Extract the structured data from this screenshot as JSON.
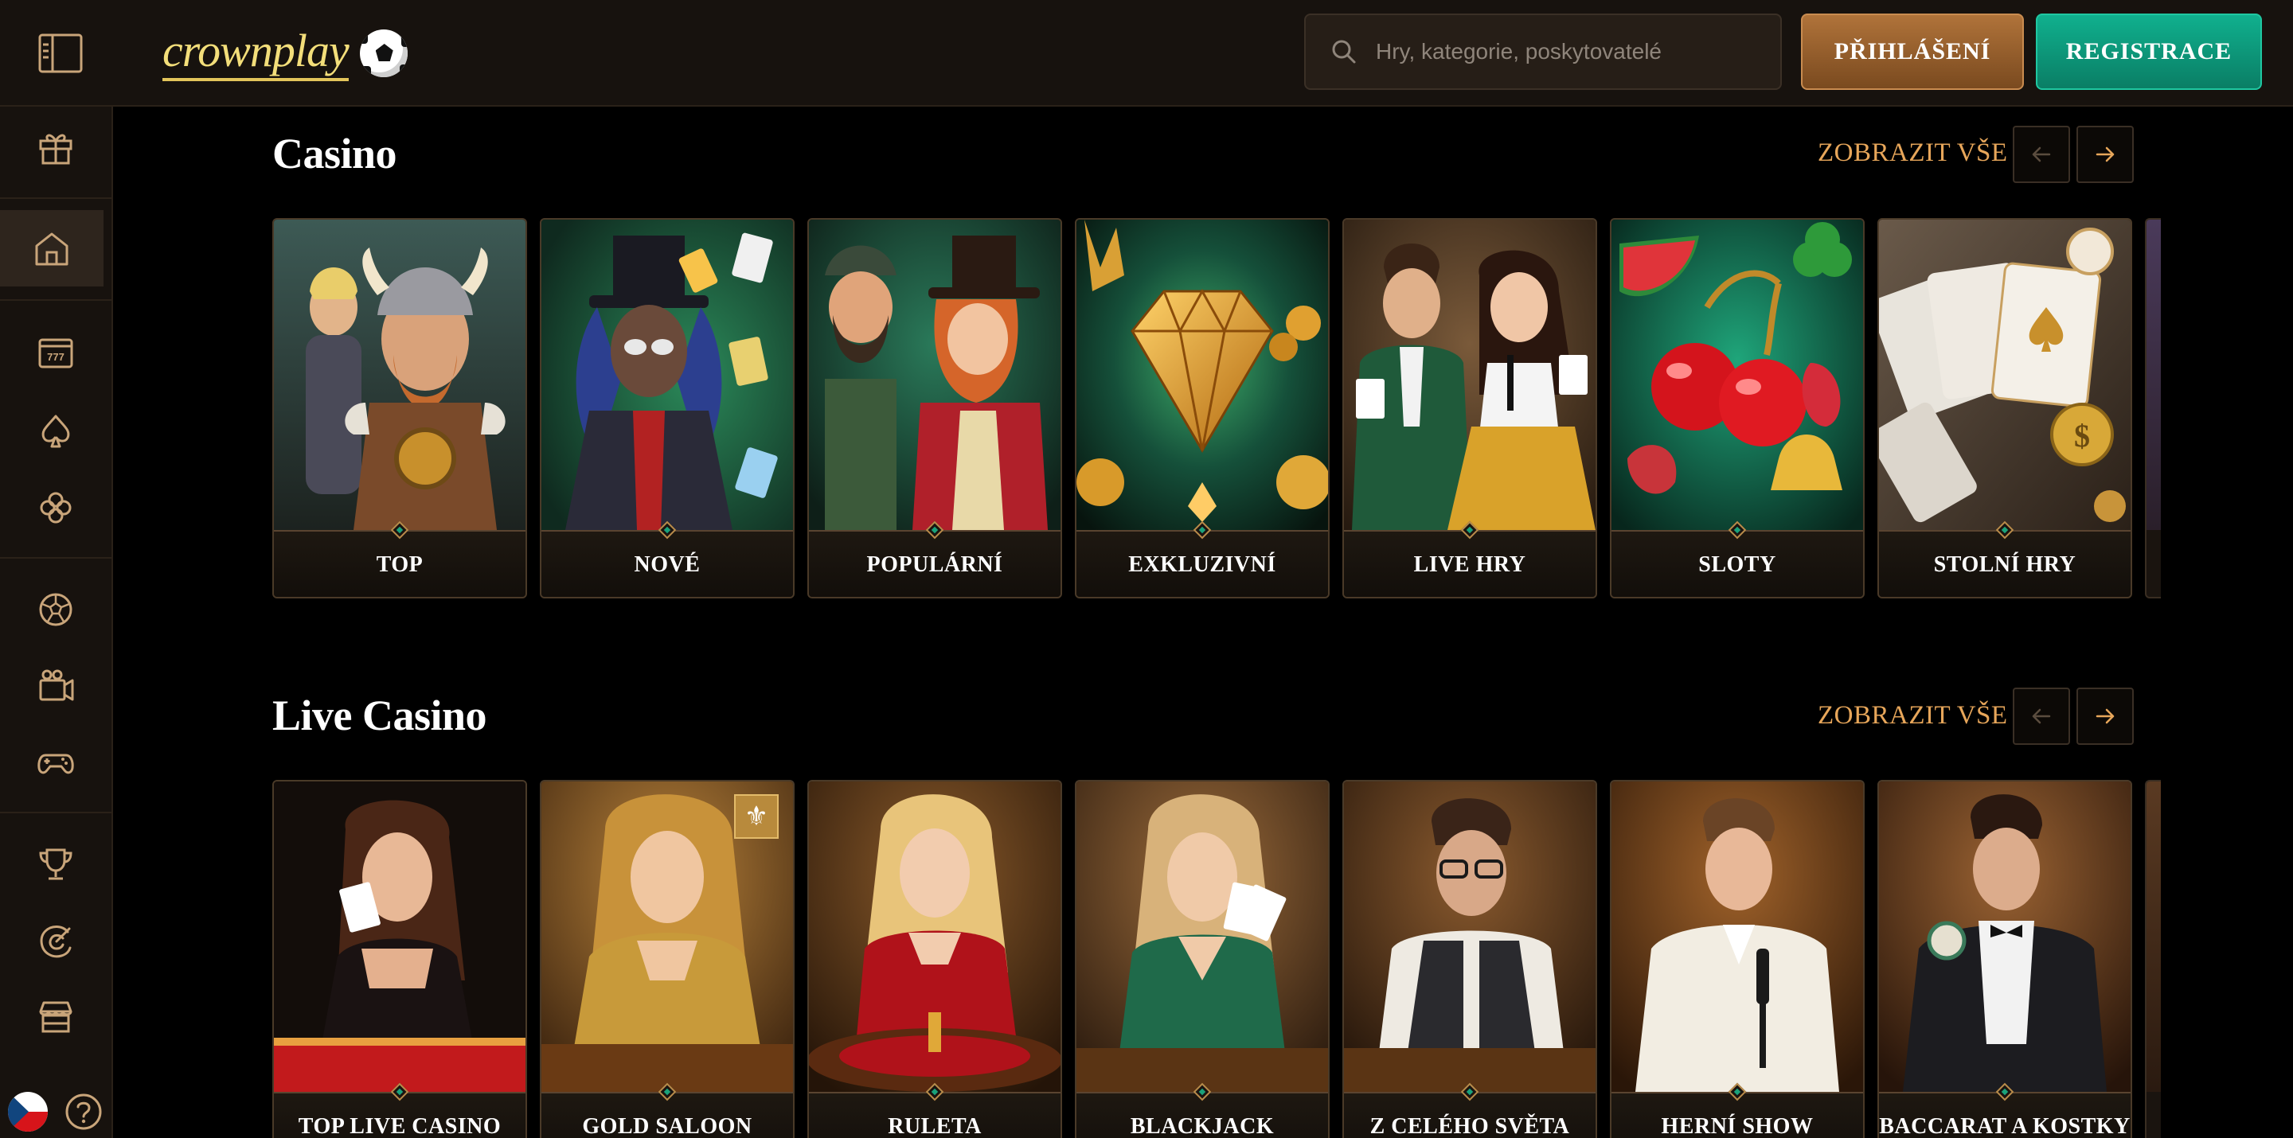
{
  "header": {
    "brand": "crownplay",
    "search_placeholder": "Hry, kategorie, poskytovatelé",
    "login_label": "PŘIHLÁŠENÍ",
    "register_label": "REGISTRACE"
  },
  "sidebar": {
    "items": [
      {
        "name": "gift-icon"
      },
      {
        "name": "home-icon"
      },
      {
        "name": "slot-machine-icon"
      },
      {
        "name": "spade-icon"
      },
      {
        "name": "clover-icon"
      },
      {
        "name": "soccer-ball-icon"
      },
      {
        "name": "tv-icon"
      },
      {
        "name": "gamepad-icon"
      },
      {
        "name": "trophy-icon"
      },
      {
        "name": "loyalty-icon"
      },
      {
        "name": "shop-icon"
      }
    ],
    "language": "cz-flag-icon"
  },
  "casino": {
    "title": "Casino",
    "view_all": "ZOBRAZIT VŠE",
    "cards": [
      {
        "label": "TOP",
        "theme": "viking"
      },
      {
        "label": "NOVÉ",
        "theme": "magician"
      },
      {
        "label": "POPULÁRNÍ",
        "theme": "gnome"
      },
      {
        "label": "EXKLUZIVNÍ",
        "theme": "diamond"
      },
      {
        "label": "LIVE HRY",
        "theme": "dealers"
      },
      {
        "label": "SLOTY",
        "theme": "fruits"
      },
      {
        "label": "STOLNÍ HRY",
        "theme": "cards"
      }
    ]
  },
  "live_casino": {
    "title": "Live Casino",
    "view_all": "ZOBRAZIT VŠE",
    "cards": [
      {
        "label": "TOP LIVE CASINO",
        "theme": "dealer-black"
      },
      {
        "label": "GOLD SALOON",
        "theme": "dealer-gold"
      },
      {
        "label": "RULETA",
        "theme": "dealer-red"
      },
      {
        "label": "BLACKJACK",
        "theme": "dealer-green"
      },
      {
        "label": "Z CELÉHO SVĚTA",
        "theme": "dealer-vest"
      },
      {
        "label": "HERNÍ SHOW",
        "theme": "host-white"
      },
      {
        "label": "BACCARAT A KOSTKY",
        "theme": "dealer-bowtie"
      }
    ]
  },
  "colors": {
    "accent_gold": "#e7a65a",
    "login_brown": "#a56c36",
    "register_green": "#10a585",
    "panel": "#17120e"
  }
}
